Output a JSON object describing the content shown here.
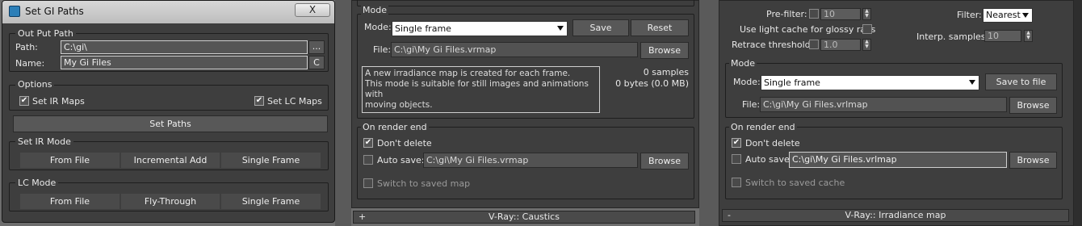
{
  "dialog": {
    "title": "Set GI Paths",
    "close_label": "X",
    "output_path": {
      "group_label": "Out Put Path",
      "path_label": "Path:",
      "path_value": "C:\\gi\\",
      "browse_label": "...",
      "name_label": "Name:",
      "name_value": "My Gi Files",
      "clear_label": "C"
    },
    "options": {
      "group_label": "Options",
      "set_ir_maps_label": "Set IR Maps",
      "set_lc_maps_label": "Set LC Maps"
    },
    "set_paths_label": "Set Paths",
    "ir_mode": {
      "group_label": "Set IR Mode",
      "buttons": [
        "From File",
        "Incremental Add",
        "Single Frame"
      ]
    },
    "lc_mode": {
      "group_label": "LC Mode",
      "buttons": [
        "From File",
        "Fly-Through",
        "Single Frame"
      ]
    }
  },
  "irradiance_panel": {
    "mode_group": "Mode",
    "mode_label": "Mode:",
    "mode_value": "Single frame",
    "save_label": "Save",
    "reset_label": "Reset",
    "file_label": "File:",
    "file_value": "C:\\gi\\My Gi Files.vrmap",
    "browse_label": "Browse",
    "description": [
      "A new irradiance map is created for each frame.",
      "This mode is suitable for still images and animations with",
      "moving objects."
    ],
    "samples_text": "0 samples",
    "bytes_text": "0 bytes (0.0 MB)",
    "render_end_group": "On render end",
    "dont_delete_label": "Don't delete",
    "auto_save_label": "Auto save:",
    "auto_save_value": "C:\\gi\\My Gi Files.vrmap",
    "auto_browse_label": "Browse",
    "switch_label": "Switch to saved map",
    "rollout_label": "V-Ray:: Caustics",
    "rollout_sign": "+"
  },
  "light_cache_panel": {
    "prefilter_label": "Pre-filter:",
    "prefilter_value": "10",
    "glossy_label": "Use light cache for glossy rays",
    "retrace_label": "Retrace threshold:",
    "retrace_value": "1.0",
    "filter_label": "Filter:",
    "filter_value": "Nearest",
    "interp_label": "Interp. samples:",
    "interp_value": "10",
    "mode_group": "Mode",
    "mode_label": "Mode:",
    "mode_value": "Single frame",
    "save_to_file_label": "Save to file",
    "file_label": "File:",
    "file_value": "C:\\gi\\My Gi Files.vrlmap",
    "browse_label": "Browse",
    "render_end_group": "On render end",
    "dont_delete_label": "Don't delete",
    "auto_save_label": "Auto save:",
    "auto_save_value": "C:\\gi\\My Gi Files.vrlmap",
    "auto_browse_label": "Browse",
    "switch_label": "Switch to saved cache",
    "rollout_label": "V-Ray:: Irradiance map",
    "rollout_sign": "-"
  }
}
